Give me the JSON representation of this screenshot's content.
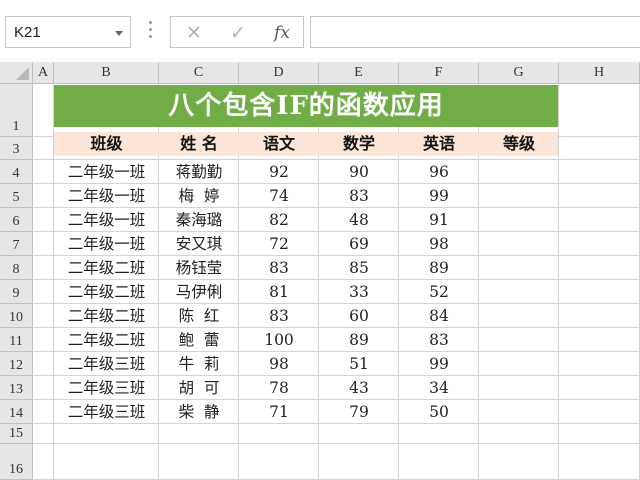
{
  "formula_bar": {
    "name_box": "K21",
    "cancel_icon": "✕",
    "enter_icon": "✓",
    "fx_label": "fx",
    "formula": ""
  },
  "columns": [
    "A",
    "B",
    "C",
    "D",
    "E",
    "F",
    "G",
    "H"
  ],
  "rows": [
    "1",
    "3",
    "4",
    "5",
    "6",
    "7",
    "8",
    "9",
    "10",
    "11",
    "12",
    "13",
    "14",
    "15",
    "16"
  ],
  "title": "八个包含IF的函数应用",
  "headers": [
    "班级",
    "姓  名",
    "语文",
    "数学",
    "英语",
    "等级"
  ],
  "students": [
    {
      "class": "二年级一班",
      "name": "蒋勤勤",
      "chinese": "92",
      "math": "90",
      "english": "96",
      "grade": ""
    },
    {
      "class": "二年级一班",
      "name": "梅  婷",
      "chinese": "74",
      "math": "83",
      "english": "99",
      "grade": ""
    },
    {
      "class": "二年级一班",
      "name": "秦海璐",
      "chinese": "82",
      "math": "48",
      "english": "91",
      "grade": ""
    },
    {
      "class": "二年级一班",
      "name": "安又琪",
      "chinese": "72",
      "math": "69",
      "english": "98",
      "grade": ""
    },
    {
      "class": "二年级二班",
      "name": "杨钰莹",
      "chinese": "83",
      "math": "85",
      "english": "89",
      "grade": ""
    },
    {
      "class": "二年级二班",
      "name": "马伊俐",
      "chinese": "81",
      "math": "33",
      "english": "52",
      "grade": ""
    },
    {
      "class": "二年级二班",
      "name": "陈  红",
      "chinese": "83",
      "math": "60",
      "english": "84",
      "grade": ""
    },
    {
      "class": "二年级二班",
      "name": "鲍  蕾",
      "chinese": "100",
      "math": "89",
      "english": "83",
      "grade": ""
    },
    {
      "class": "二年级三班",
      "name": "牛  莉",
      "chinese": "98",
      "math": "51",
      "english": "99",
      "grade": ""
    },
    {
      "class": "二年级三班",
      "name": "胡  可",
      "chinese": "78",
      "math": "43",
      "english": "34",
      "grade": ""
    },
    {
      "class": "二年级三班",
      "name": "柴  静",
      "chinese": "71",
      "math": "79",
      "english": "50",
      "grade": ""
    }
  ],
  "colors": {
    "title_bg": "#70ad47",
    "header_bg": "#fbe5d6",
    "title_text": "#ffffff"
  }
}
